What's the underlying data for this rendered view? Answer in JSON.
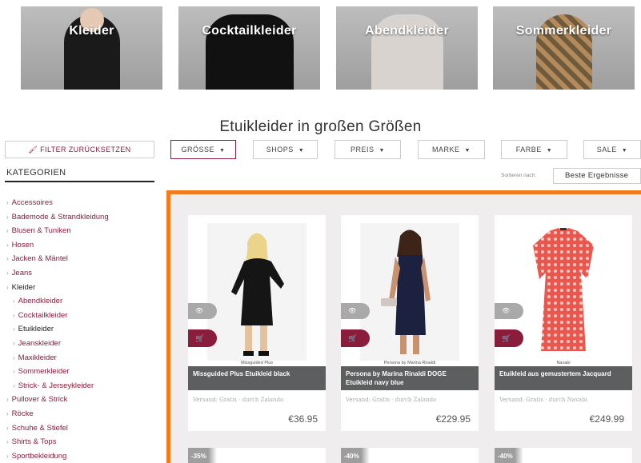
{
  "hero": {
    "tiles": [
      {
        "label": "Kleider"
      },
      {
        "label": "Cocktailkleider"
      },
      {
        "label": "Abendkleider"
      },
      {
        "label": "Sommerkleider"
      }
    ]
  },
  "title": "Etuikleider in großen Größen",
  "filters": {
    "reset": "FILTER ZURÜCKSETZEN",
    "buttons": [
      "GRÖSSE",
      "SHOPS",
      "PREIS",
      "MARKE",
      "FARBE",
      "SALE"
    ]
  },
  "sidebar": {
    "title": "KATEGORIEN",
    "items": [
      "Accessoires",
      "Bademode & Strandkleidung",
      "Blusen & Tuniken",
      "Hosen",
      "Jacken & Mäntel",
      "Jeans",
      "Kleider",
      "Abendkleider",
      "Cocktailkleider",
      "Etuikleider",
      "Jeanskleider",
      "Maxikleider",
      "Sommerkleider",
      "Strick- & Jerseykleider",
      "Pullover & Strick",
      "Röcke",
      "Schuhe & Stiefel",
      "Shirts & Tops",
      "Sportbekleidung"
    ]
  },
  "sort": {
    "label": "Sortieren nach:",
    "value": "Beste Ergebnisse"
  },
  "products": [
    {
      "brand": "Missguided Plus",
      "name": "Missguided Plus Etuikleid black",
      "shipping": "Versand: Gratis · durch Zalando",
      "price": "€36.95"
    },
    {
      "brand": "Persona by Marina Rinaldi",
      "name": "Persona by Marina Rinaldi DOGE Etuikleid navy blue",
      "shipping": "Versand: Gratis · durch Zalando",
      "price": "€229.95"
    },
    {
      "brand": "Navabi",
      "name": "Etuikleid aus gemustertem Jacquard",
      "shipping": "Versand: Gratis · durch Navabi",
      "price": "€249.99"
    }
  ],
  "badges": [
    "-35%",
    "-40%",
    "-40%"
  ],
  "colors": {
    "accent": "#8a1d3b",
    "frame": "#f07c1e",
    "name_bar": "#5d5e60"
  }
}
